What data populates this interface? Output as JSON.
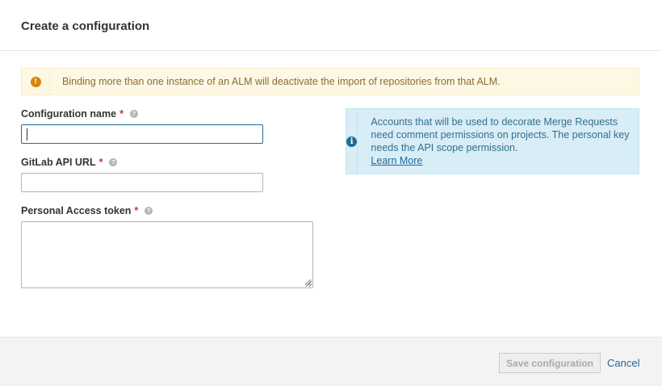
{
  "modal": {
    "title": "Create a configuration"
  },
  "warning": {
    "icon": "exclamation-icon",
    "text": "Binding more than one instance of an ALM will deactivate the import of repositories from that ALM.",
    "color": "#fcf8e3"
  },
  "form": {
    "configuration_name": {
      "label": "Configuration name",
      "required_mark": "*",
      "value": "",
      "help_icon": "question-icon"
    },
    "gitlab_api_url": {
      "label": "GitLab API URL",
      "required_mark": "*",
      "value": "",
      "help_icon": "question-icon"
    },
    "personal_access_token": {
      "label": "Personal Access token",
      "required_mark": "*",
      "value": "",
      "help_icon": "question-icon"
    }
  },
  "info": {
    "icon": "info-icon",
    "text": "Accounts that will be used to decorate Merge Requests need comment permissions on projects. The personal key needs the API scope permission.",
    "link_text": "Learn More",
    "color": "#d9edf7"
  },
  "footer": {
    "save_label": "Save configuration",
    "cancel_label": "Cancel"
  },
  "colors": {
    "accent": "#236a97",
    "required": "#d02f3a"
  }
}
